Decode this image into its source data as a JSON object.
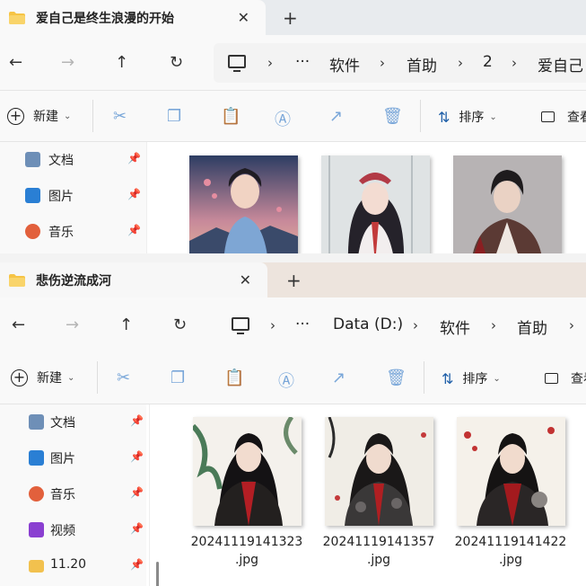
{
  "window1": {
    "tab_title": "爱自己是终生浪漫的开始",
    "breadcrumbs": [
      "···",
      "软件",
      "首助",
      "2",
      "爱自己"
    ],
    "toolbar": {
      "new_label": "新建",
      "sort_label": "排序",
      "view_label": "查看"
    },
    "sidebar": [
      {
        "label": "文档",
        "icon": "document-icon",
        "color": "#6e8fb7"
      },
      {
        "label": "图片",
        "icon": "pictures-icon",
        "color": "#2a7fd4"
      },
      {
        "label": "音乐",
        "icon": "music-icon",
        "color": "#e2603c"
      }
    ]
  },
  "window2": {
    "tab_title": "悲伤逆流成河",
    "breadcrumbs": [
      "···",
      "Data (D:)",
      "软件",
      "首助"
    ],
    "toolbar": {
      "new_label": "新建",
      "sort_label": "排序",
      "view_label": "查看"
    },
    "sidebar": [
      {
        "label": "文档",
        "icon": "document-icon",
        "color": "#6e8fb7"
      },
      {
        "label": "图片",
        "icon": "pictures-icon",
        "color": "#2a7fd4"
      },
      {
        "label": "音乐",
        "icon": "music-icon",
        "color": "#e2603c"
      },
      {
        "label": "视频",
        "icon": "video-icon",
        "color": "#8a3fd1"
      },
      {
        "label": "11.20",
        "icon": "folder-icon",
        "color": "#f2c14e"
      }
    ],
    "files": [
      {
        "line1": "20241119141323",
        "line2": ".jpg"
      },
      {
        "line1": "20241119141357",
        "line2": ".jpg"
      },
      {
        "line1": "20241119141422",
        "line2": ".jpg"
      }
    ]
  },
  "colors": {
    "folder": "#f6c445",
    "accent": "#1f5fa8"
  }
}
